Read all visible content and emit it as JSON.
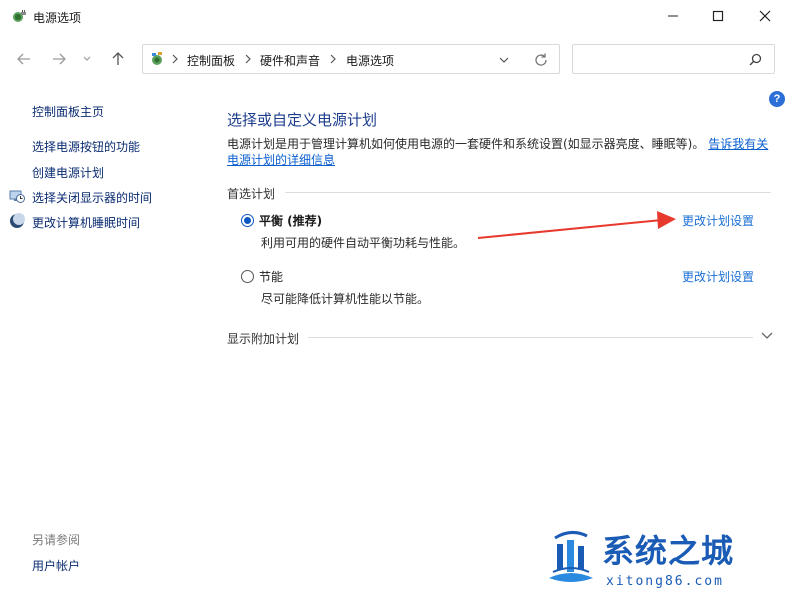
{
  "window": {
    "title": "电源选项",
    "buttons": {
      "minimize": "minimize-icon",
      "maximize": "maximize-icon",
      "close": "close-icon"
    }
  },
  "nav": {
    "breadcrumb": [
      "控制面板",
      "硬件和声音",
      "电源选项"
    ],
    "search_placeholder": ""
  },
  "sidebar": {
    "home": "控制面板主页",
    "tasks": [
      {
        "label": "选择电源按钮的功能",
        "icon": null
      },
      {
        "label": "创建电源计划",
        "icon": null
      },
      {
        "label": "选择关闭显示器的时间",
        "icon": "monitor-clock-icon"
      },
      {
        "label": "更改计算机睡眠时间",
        "icon": "moon-icon"
      }
    ],
    "see_also_title": "另请参阅",
    "see_also": [
      "用户帐户"
    ]
  },
  "main": {
    "heading": "选择或自定义电源计划",
    "description": "电源计划是用于管理计算机如何使用电源的一套硬件和系统设置(如显示器亮度、睡眠等)。",
    "description_link": "告诉我有关电源计划的详细信息",
    "preferred_label": "首选计划",
    "plans": [
      {
        "name": "平衡 (推荐)",
        "description": "利用可用的硬件自动平衡功耗与性能。",
        "selected": true,
        "link": "更改计划设置"
      },
      {
        "name": "节能",
        "description": "尽可能降低计算机性能以节能。",
        "selected": false,
        "link": "更改计划设置"
      }
    ],
    "additional_label": "显示附加计划"
  },
  "watermark": {
    "title": "系统之城",
    "url": "xitong86.com"
  },
  "colors": {
    "link": "#1a6fd4",
    "heading": "#1c3d8c",
    "arrow": "#e8392f",
    "watermark": "#1a5bb5"
  }
}
